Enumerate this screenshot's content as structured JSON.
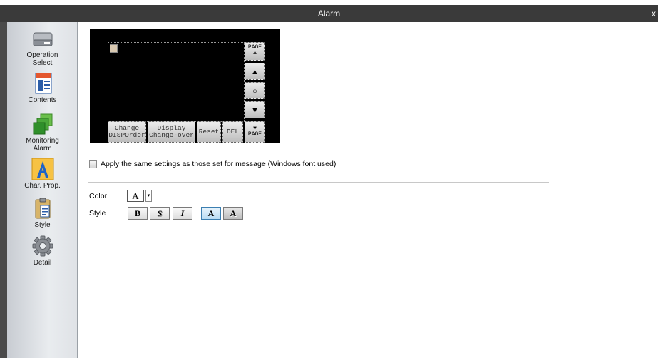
{
  "window": {
    "title": "Alarm",
    "close_glyph": "x"
  },
  "sidebar": {
    "items": [
      {
        "label": "Operation\nSelect",
        "icon": "operation-select-icon"
      },
      {
        "label": "Contents",
        "icon": "contents-icon"
      },
      {
        "label": "Monitoring\nAlarm",
        "icon": "monitoring-alarm-icon"
      },
      {
        "label": "Char. Prop.",
        "icon": "char-prop-icon",
        "selected": true
      },
      {
        "label": "Style",
        "icon": "style-icon"
      },
      {
        "label": "Detail",
        "icon": "detail-icon"
      }
    ]
  },
  "preview": {
    "page_up_label": "PAGE\n▲",
    "up_label": "▲",
    "enter_label": "○",
    "down_label": "▼",
    "page_down_label": "▼\nPAGE",
    "change_order_label": "Change\nDISPOrder",
    "display_changeover_label": "Display\nChange-over",
    "reset_label": "Reset",
    "del_label": "DEL"
  },
  "apply_same": {
    "label": "Apply the same settings as those set for message (Windows font used)",
    "checked": false
  },
  "color": {
    "label": "Color",
    "value_glyph": "A",
    "dropdown_glyph": "▾"
  },
  "style": {
    "label": "Style",
    "buttons": [
      {
        "glyph": "B",
        "name": "bold",
        "active": false
      },
      {
        "glyph": "S",
        "name": "shadow",
        "active": false
      },
      {
        "glyph": "I",
        "name": "italic",
        "active": false
      },
      {
        "glyph": "A",
        "name": "solid",
        "active": true
      },
      {
        "glyph": "A",
        "name": "raised",
        "active": false
      }
    ]
  },
  "colors": {
    "accent": "#3c7fb1",
    "titlebar": "#3a3a3a",
    "preview_bg": "#000000"
  }
}
